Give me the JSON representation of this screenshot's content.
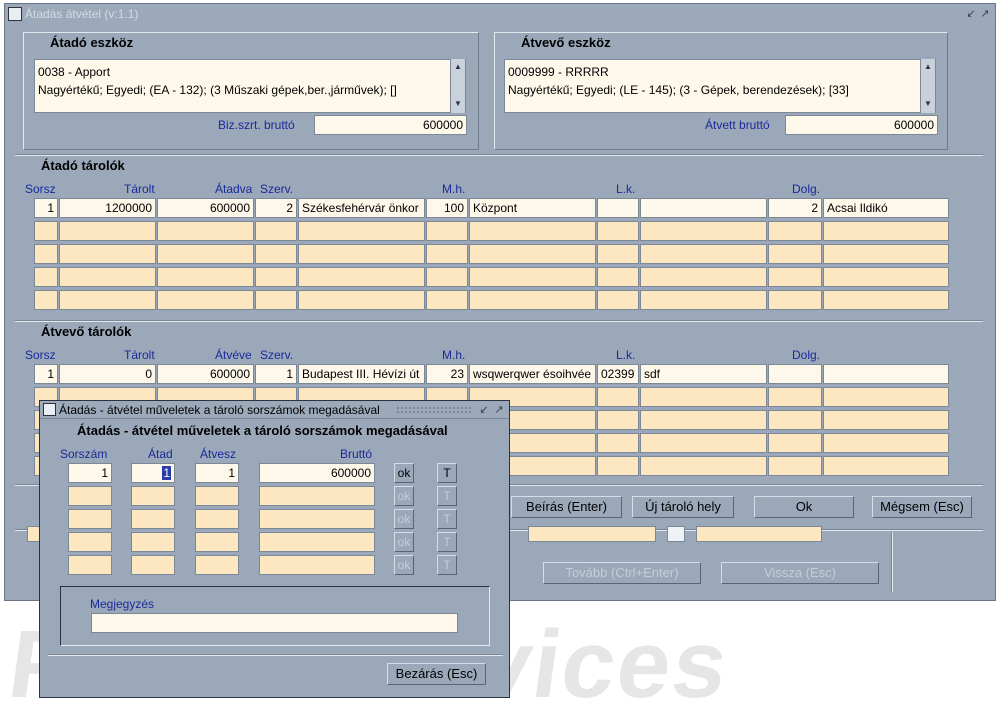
{
  "window": {
    "title": "Átadás átvétel (v:1.1)"
  },
  "atado_eszkoz": {
    "title": "Átadó eszköz",
    "line1": "0038 - Apport",
    "line2": "Nagyértékű; Egyedi; (EA - 132); (3 Műszaki gépek,ber.,járművek); []",
    "brutto_label": "Biz.szrt. bruttó",
    "brutto_value": "600000"
  },
  "atvevo_eszkoz": {
    "title": "Átvevő eszköz",
    "line1": "0009999 - RRRRR",
    "line2": "Nagyértékű; Egyedi; (LE - 145); (3 - Gépek, berendezések); [33]",
    "brutto_label": "Átvett bruttó",
    "brutto_value": "600000"
  },
  "atado_tarolok": {
    "title": "Átadó tárolók",
    "headers": {
      "sorsz": "Sorsz",
      "tarolt": "Tárolt",
      "atadva": "Átadva",
      "szerv": "Szerv.",
      "mh": "M.h.",
      "lk": "L.k.",
      "dolg": "Dolg."
    },
    "row": {
      "sorsz": "1",
      "tarolt": "1200000",
      "atadva": "600000",
      "szerv": "2",
      "szerv_name": "Székesfehérvár önkor",
      "mh": "100",
      "mh_name": "Központ",
      "lk": "",
      "lk_name": "",
      "dolg": "2",
      "dolg_name": "Acsai Ildikó"
    }
  },
  "atvevo_tarolok": {
    "title": "Átvevő tárolók",
    "headers": {
      "sorsz": "Sorsz",
      "tarolt": "Tárolt",
      "atveve": "Átvéve",
      "szerv": "Szerv.",
      "mh": "M.h.",
      "lk": "L.k.",
      "dolg": "Dolg."
    },
    "row": {
      "sorsz": "1",
      "tarolt": "0",
      "atveve": "600000",
      "szerv": "1",
      "szerv_name": "Budapest III. Hévízi út",
      "mh": "23",
      "mh_name": "wsqwerqwer ésoihvée",
      "lk": "02399",
      "lk_name": "sdf",
      "dolg": "",
      "dolg_name": ""
    }
  },
  "buttons": {
    "beiras": "Beírás (Enter)",
    "uj_tarolo": "Új tároló hely",
    "ok": "Ok",
    "megsem": "Mégsem (Esc)",
    "tovabb": "Tovább (Ctrl+Enter)",
    "vissza": "Vissza (Esc)"
  },
  "dialog": {
    "title": "Átadás - átvétel műveletek a tároló sorszámok megadásával",
    "heading": "Átadás - átvétel műveletek a tároló sorszámok megadásával",
    "headers": {
      "sorszam": "Sorszám",
      "atad": "Átad",
      "atvesz": "Átvesz",
      "brutto": "Bruttó"
    },
    "row": {
      "sorszam": "1",
      "atad": "1",
      "atvesz": "1",
      "brutto": "600000"
    },
    "ok_label": "ok",
    "t_label": "T",
    "megjegyzes_label": "Megjegyzés",
    "megjegyzes_value": "",
    "close_label": "Bezárás (Esc)"
  },
  "watermark": "Prolis Services"
}
